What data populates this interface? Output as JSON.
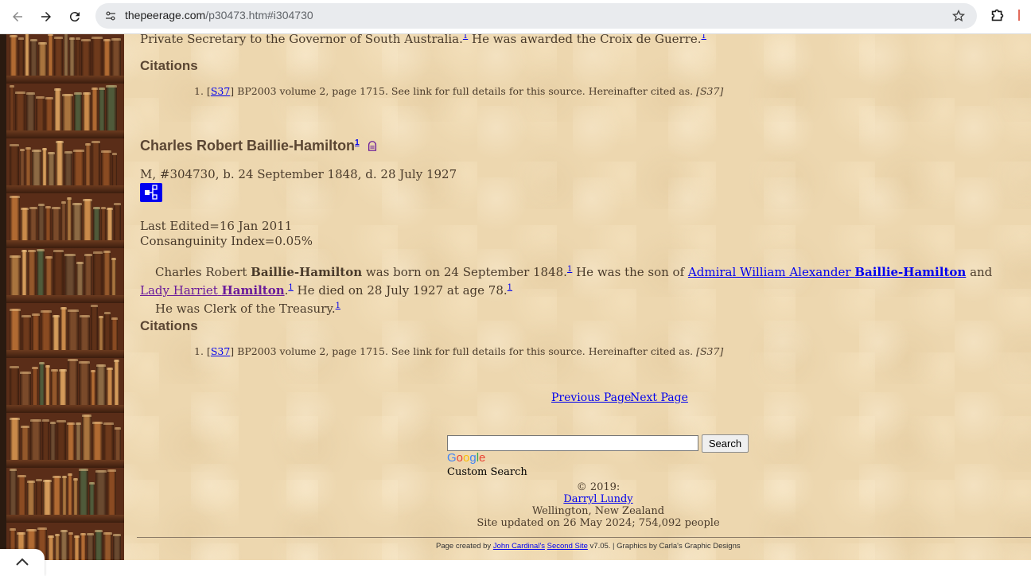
{
  "browser": {
    "url_host": "thepeerage.com",
    "url_path": "/p30473.htm#i304730"
  },
  "prev_entry": {
    "text_a": "Private Secretary to the Governor of South Australia.",
    "sup_a": "1",
    "text_b": " He was awarded the Croix de Guerre.",
    "sup_b": "1",
    "citations_heading": "Citations",
    "citation_num": "1.",
    "citation_open": "[",
    "citation_link": "S37",
    "citation_close": "]",
    "citation_text": " BP2003 volume 2, page 1715. See link for full details for this source. Hereinafter cited as. ",
    "citation_ital": "[S37]"
  },
  "person": {
    "name": "Charles Robert Baillie-Hamilton",
    "name_sup": "1",
    "summary": "M, #304730, b. 24 September 1848, d. 28 July 1927",
    "last_edited": "Last Edited=16 Jan 2011",
    "consanguinity": "Consanguinity Index=0.05%",
    "bio_1a": "Charles Robert ",
    "bio_1b": "Baillie-Hamilton",
    "bio_1c": " was born on 24 September 1848.",
    "bio_1_sup": "1",
    "bio_1d": " He was the son of ",
    "father_a": "Admiral William Alexander ",
    "father_b": "Baillie-Hamilton",
    "bio_1e": " and ",
    "mother_a": "Lady Harriet",
    "mother_b": "Hamilton",
    "bio_1f": ".",
    "bio_1f_sup": "1",
    "bio_1g": " He died on 28 July 1927 at age 78.",
    "bio_1g_sup": "1",
    "bio_2": "He was Clerk of the Treasury.",
    "bio_2_sup": "1",
    "citations_heading": "Citations",
    "citation_num": "1.",
    "citation_open": "[",
    "citation_link": "S37",
    "citation_close": "]",
    "citation_text": " BP2003 volume 2, page 1715. See link for full details for this source. Hereinafter cited as. ",
    "citation_ital": "[S37]"
  },
  "nav": {
    "previous": "Previous Page",
    "next": "Next Page"
  },
  "search": {
    "button": "Search",
    "google_letters": [
      "G",
      "o",
      "o",
      "g",
      "l",
      "e"
    ],
    "custom_search": "Custom Search"
  },
  "footer": {
    "copyright": "© 2019:",
    "author": "Darryl Lundy",
    "location": "Wellington, New Zealand",
    "updated": "Site updated on 26 May 2024; 754,092 people",
    "created_prefix": "Page created by ",
    "cardinal": "John Cardinal's",
    "second_site": "Second Site",
    "version": " v7.05.  |  Graphics by Carla's Graphic Designs"
  },
  "colors": {
    "page_bg": "#edd7af",
    "link": "#0000ee",
    "visited": "#6a1b9a",
    "text": "#4a3b2b"
  }
}
